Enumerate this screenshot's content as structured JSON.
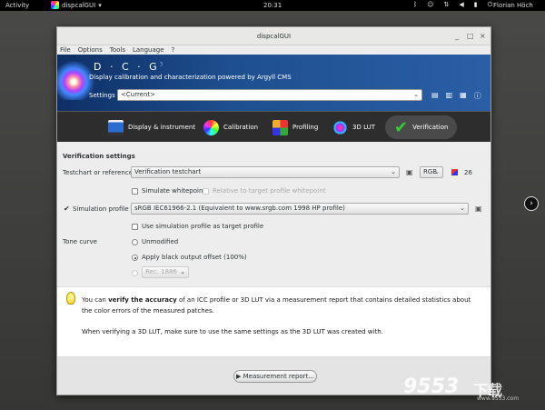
{
  "topbar": {
    "activities": "Activity",
    "app_name": "dispcalGUI",
    "app_menu_arrow": "▾",
    "clock": "20:31",
    "user": "Florian Höch",
    "tray_icons": [
      "bluetooth-icon",
      "accessibility-icon",
      "network-icon",
      "volume-icon",
      "battery-icon",
      "power-icon"
    ]
  },
  "window": {
    "title": "dispcalGUI",
    "controls": [
      "_",
      "□",
      "×"
    ]
  },
  "menubar": [
    "File",
    "Options",
    "Tools",
    "Language",
    "?"
  ],
  "banner": {
    "logo": "D · C · G",
    "logo_sup": "3",
    "tagline": "Display calibration and characterization powered by Argyll CMS",
    "settings_label": "Settings",
    "settings_value": "<Current>"
  },
  "tabs": [
    {
      "label": "Display & instrument",
      "icon": "display-icon"
    },
    {
      "label": "Calibration",
      "icon": "color-wheel-icon"
    },
    {
      "label": "Profiling",
      "icon": "color-grid-icon"
    },
    {
      "label": "3D LUT",
      "icon": "lut-cube-icon"
    },
    {
      "label": "Verification",
      "icon": "checkmark-icon"
    }
  ],
  "verification": {
    "section_title": "Verification settings",
    "testchart_label": "Testchart or reference",
    "testchart_value": "Verification testchart",
    "colorspace_value": "RGB",
    "patch_count": "26",
    "simulate_whitepoint": "Simulate whitepoint",
    "relative_whitepoint": "Relative to target profile whitepoint",
    "simulation_profile_label": "Simulation profile",
    "simulation_profile_value": "sRGB IEC61966-2.1 (Equivalent to www.srgb.com 1998 HP profile)",
    "use_simulation_target": "Use simulation profile as target profile",
    "tone_curve_label": "Tone curve",
    "tone_unmodified": "Unmodified",
    "tone_black_offset": "Apply black output offset (100%)",
    "tone_rec_value": "Rec. 1886"
  },
  "info": {
    "line1_pre": "You can ",
    "line1_bold": "verify the accuracy",
    "line1_post": " of an ICC profile or 3D LUT via a measurement report that contains detailed statistics about",
    "line2": "the color errors of the measured patches.",
    "line3": "When verifying a 3D LUT, make sure to use the same settings as the 3D LUT was created with."
  },
  "footer": {
    "button_icon": "▶",
    "button_label": "Measurement report..."
  },
  "watermark": {
    "number": "9553",
    "chinese": "下载",
    "domain": "www.9553.com"
  }
}
